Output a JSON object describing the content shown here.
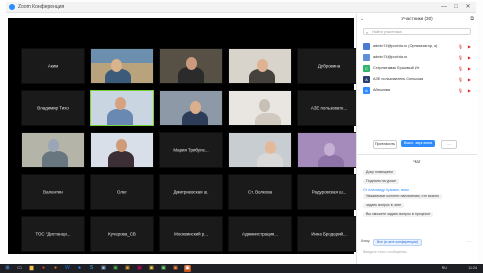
{
  "window": {
    "title": "Zoom Конференция",
    "minimize": "—",
    "maximize": "□",
    "close": "✕"
  },
  "grid": {
    "tiles": [
      {
        "name": "Аким",
        "type": "name"
      },
      {
        "name": "",
        "type": "video",
        "scene": "room"
      },
      {
        "name": "",
        "type": "video",
        "scene": "person-dark"
      },
      {
        "name": "",
        "type": "video",
        "scene": "person-light"
      },
      {
        "name": "Дубровина",
        "type": "name"
      },
      {
        "name": "Владимир Тихо",
        "type": "name"
      },
      {
        "name": "",
        "type": "video",
        "scene": "active-speaker"
      },
      {
        "name": "",
        "type": "video",
        "scene": "person-glasses"
      },
      {
        "name": "",
        "type": "video",
        "scene": "wall"
      },
      {
        "name": "АЗЕ пользовате...",
        "type": "name"
      },
      {
        "name": "",
        "type": "video",
        "scene": "painting"
      },
      {
        "name": "",
        "type": "video",
        "scene": "person-front"
      },
      {
        "name": "Мария Трибуле...",
        "type": "name"
      },
      {
        "name": "",
        "type": "video",
        "scene": "bald-man"
      },
      {
        "name": "",
        "type": "video",
        "scene": "purple"
      },
      {
        "name": "Валентин",
        "type": "name"
      },
      {
        "name": "Олег",
        "type": "name"
      },
      {
        "name": "Дмитриевская ш.",
        "type": "name"
      },
      {
        "name": "Ст. Волкова",
        "type": "name"
      },
      {
        "name": "Радуровская ш...",
        "type": "name"
      },
      {
        "name": "ТОС \"Дистанци...",
        "type": "name"
      },
      {
        "name": "Кучерова_СВ",
        "type": "name"
      },
      {
        "name": "Москвинский р...",
        "type": "name"
      },
      {
        "name": "Администрация...",
        "type": "name"
      },
      {
        "name": "Инна Бродерий...",
        "type": "name"
      }
    ]
  },
  "participants_panel": {
    "title": "Участники (30)",
    "search_placeholder": "Найти участника",
    "rows": [
      {
        "initial": "",
        "name": "admin74@pochta.ru (Организатор, я)",
        "color": "#4b7bd1"
      },
      {
        "initial": "",
        "name": "admin74@pochta.ru",
        "color": "#5f8fd8"
      },
      {
        "initial": "С",
        "name": "Стерлитамак Ершовый Ит",
        "color": "#2fb56a"
      },
      {
        "initial": "А",
        "name": "АЗЕ пользователь Сельская",
        "color": "#2b3e6f"
      },
      {
        "initial": "А",
        "name": "Айтыкова",
        "color": "#2d8cff"
      }
    ],
    "invite_label": "Пригласить",
    "mute_all_label": "Выкл. звук всем",
    "more_label": "..."
  },
  "chat": {
    "title": "Чат",
    "messages": [
      {
        "sender": "",
        "text": "Доку помещаем"
      },
      {
        "sender": "",
        "text": "Подняли на уроке"
      },
      {
        "sender": "От Александр Кузьмин, всем",
        "text": ""
      },
      {
        "sender": "",
        "text": "Уважаемые коллеги напоминаю, что можно"
      },
      {
        "sender": "",
        "text": "задать вопрос в чате"
      },
      {
        "sender": "",
        "text": "Вы сможете задать вопрос в процессе"
      }
    ],
    "to_label": "Кому:",
    "to_value": "Все (в чате конференции)",
    "input_placeholder": "Введите текст сообщения..."
  },
  "taskbar": {
    "language": "RU",
    "time": "11:24",
    "date": "25.11.2020"
  },
  "colors": {
    "accent": "#2d8cff",
    "active_speaker": "#77d338",
    "muted": "#e02828",
    "grid_bg": "#000000"
  }
}
